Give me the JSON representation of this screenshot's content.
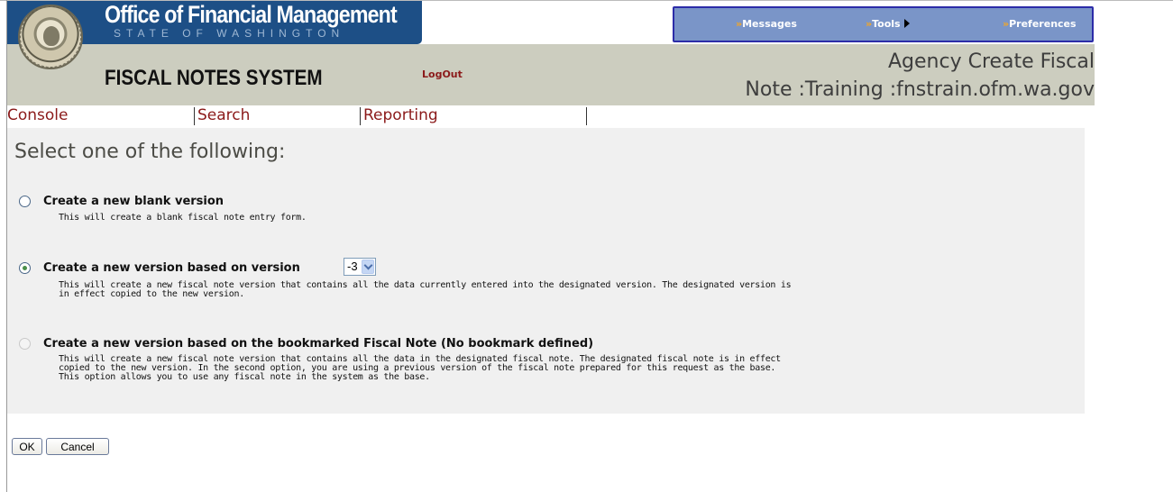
{
  "header": {
    "org_title": "Office of Financial Management",
    "org_subtitle": "STATE OF WASHINGTON",
    "system_title": "FISCAL NOTES SYSTEM",
    "logout_label": "LogOut",
    "page_title_line1": "Agency Create Fiscal",
    "page_title_line2": "Note :Training :fnstrain.ofm.wa.gov"
  },
  "topnav": {
    "items": [
      {
        "label": "Messages"
      },
      {
        "label": "Tools"
      },
      {
        "label": "Preferences"
      }
    ]
  },
  "tabs": [
    {
      "label": "Console"
    },
    {
      "label": "Search"
    },
    {
      "label": "Reporting"
    }
  ],
  "main": {
    "heading": "Select one of the following:",
    "options": [
      {
        "label": "Create a new blank version",
        "description": "This will create a blank fiscal note entry form.",
        "selected": false,
        "disabled": false
      },
      {
        "label": "Create a new version based on version",
        "description": "This will create a new fiscal note version that contains all the data currently entered into the designated version. The designated version is\nin effect copied to the new version.",
        "selected": true,
        "disabled": false,
        "version_select": {
          "value": "-3"
        }
      },
      {
        "label": "Create a new version based on the bookmarked Fiscal Note (No bookmark defined)",
        "description": "This will create a new fiscal note version that contains all the data in the designated fiscal note. The designated fiscal note is in effect\ncopied to the new version. In the second option, you are using a previous version of the fiscal note prepared for this request as the base.\nThis option allows you to use any fiscal note in the system as the base.",
        "selected": false,
        "disabled": true
      }
    ]
  },
  "actions": {
    "ok_label": "OK",
    "cancel_label": "Cancel"
  },
  "colors": {
    "header_blue": "#1d4f86",
    "header_gray": "#cccdbf",
    "nav_blue": "#7a95c8",
    "link_red": "#8b1a1a",
    "nav_arrow": "#f5a623",
    "panel_bg": "#f0f0f0"
  },
  "icons": {
    "seal": "state-seal-icon",
    "nav_arrow": "double-chevron-right-icon",
    "tools_submenu": "triangle-right-icon",
    "select_dropdown": "chevron-down-icon"
  }
}
